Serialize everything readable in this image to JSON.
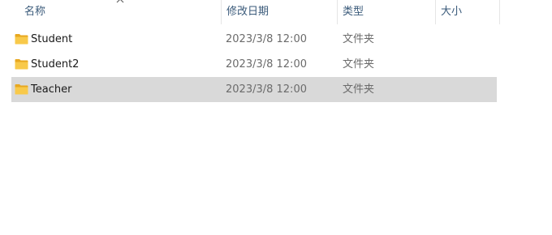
{
  "columns": {
    "name": "名称",
    "date": "修改日期",
    "type": "类型",
    "size": "大小"
  },
  "sort": {
    "column": "name",
    "direction": "ascending"
  },
  "colors": {
    "selected_row": "#d9d9d9",
    "folder_yellow": "#f8c94a",
    "folder_back": "#e8a820"
  },
  "files": [
    {
      "name": "Student",
      "date": "2023/3/8 12:00",
      "type": "文件夹",
      "size": "",
      "icon": "folder-icon",
      "selected": false
    },
    {
      "name": "Student2",
      "date": "2023/3/8 12:00",
      "type": "文件夹",
      "size": "",
      "icon": "folder-icon",
      "selected": false
    },
    {
      "name": "Teacher",
      "date": "2023/3/8 12:00",
      "type": "文件夹",
      "size": "",
      "icon": "folder-icon",
      "selected": true
    }
  ]
}
